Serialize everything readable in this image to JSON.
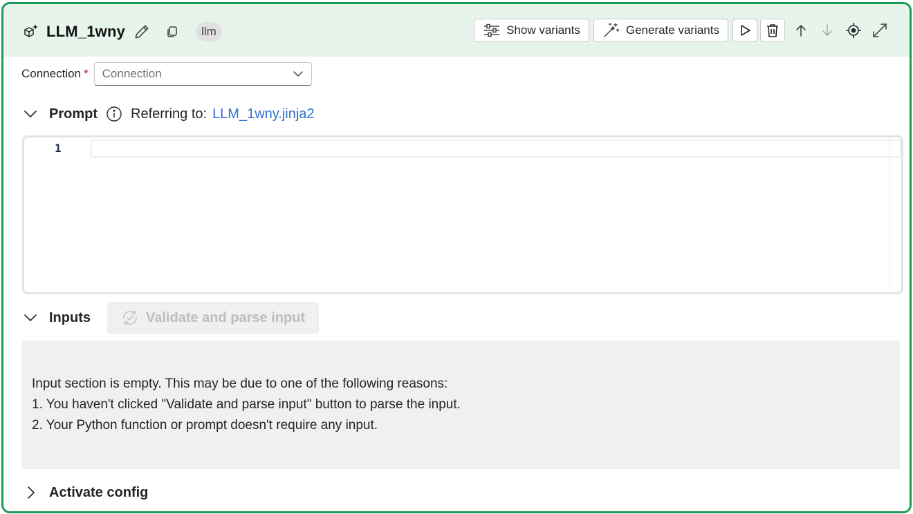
{
  "header": {
    "title": "LLM_1wny",
    "tag": "llm",
    "show_variants_label": "Show variants",
    "generate_variants_label": "Generate variants"
  },
  "connection": {
    "label": "Connection",
    "required_mark": "*",
    "placeholder": "Connection"
  },
  "prompt": {
    "title": "Prompt",
    "referring_label": "Referring to:",
    "file": "LLM_1wny.jinja2",
    "line_numbers": [
      "1"
    ]
  },
  "inputs": {
    "title": "Inputs",
    "validate_label": "Validate and parse input",
    "empty_lines": [
      "Input section is empty. This may be due to one of the following reasons:",
      "1. You haven't clicked \"Validate and parse input\" button to parse the input.",
      "2. Your Python function or prompt doesn't require any input."
    ]
  },
  "activate_config": {
    "title": "Activate config"
  },
  "colors": {
    "accent": "#1e9a58",
    "header_bg": "#e6f4ec",
    "link": "#2f6fd0",
    "required": "#c50f1f"
  }
}
